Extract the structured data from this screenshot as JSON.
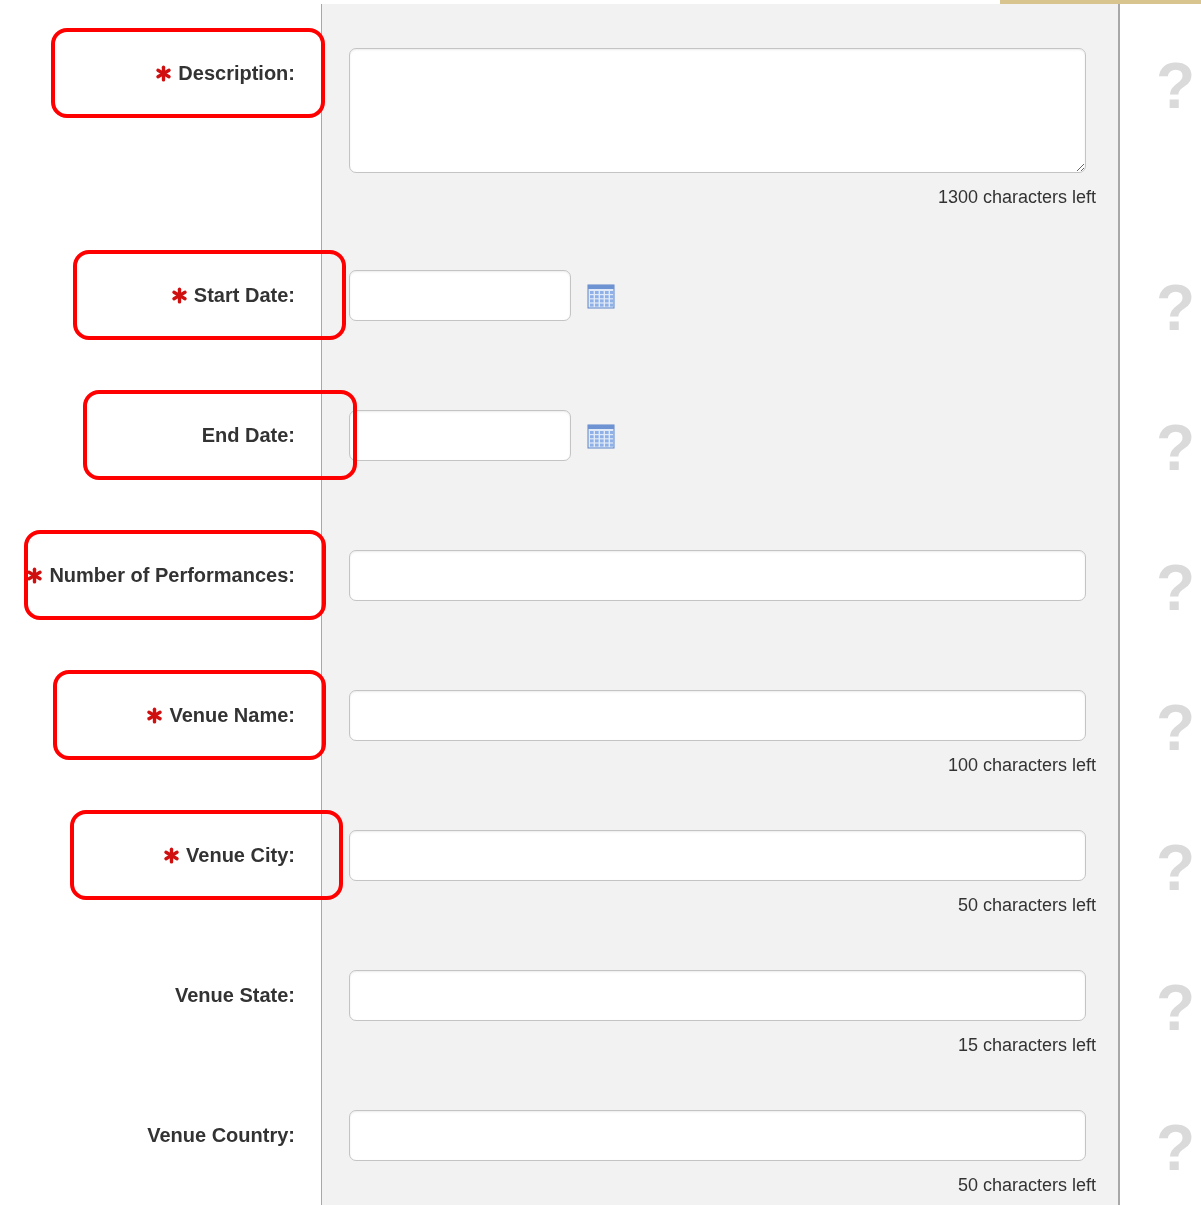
{
  "fields": [
    {
      "label": "Description:",
      "required": true,
      "highlighted": true,
      "kind": "textarea",
      "counter": "1300 characters left",
      "help": "?"
    },
    {
      "label": "Start Date:",
      "required": true,
      "highlighted": true,
      "kind": "date",
      "help": "?"
    },
    {
      "label": "End Date:",
      "required": false,
      "highlighted": true,
      "kind": "date",
      "help": "?"
    },
    {
      "label": "Number of Performances:",
      "required": true,
      "highlighted": true,
      "kind": "text",
      "help": "?"
    },
    {
      "label": "Venue Name:",
      "required": true,
      "highlighted": true,
      "kind": "text",
      "counter": "100 characters left",
      "help": "?"
    },
    {
      "label": "Venue City:",
      "required": true,
      "highlighted": true,
      "kind": "text",
      "counter": "50 characters left",
      "help": "?"
    },
    {
      "label": "Venue State:",
      "required": false,
      "highlighted": false,
      "kind": "text",
      "counter": "15 characters left",
      "help": "?"
    },
    {
      "label": "Venue Country:",
      "required": false,
      "highlighted": false,
      "kind": "text",
      "counter": "50 characters left",
      "help": "?"
    }
  ]
}
